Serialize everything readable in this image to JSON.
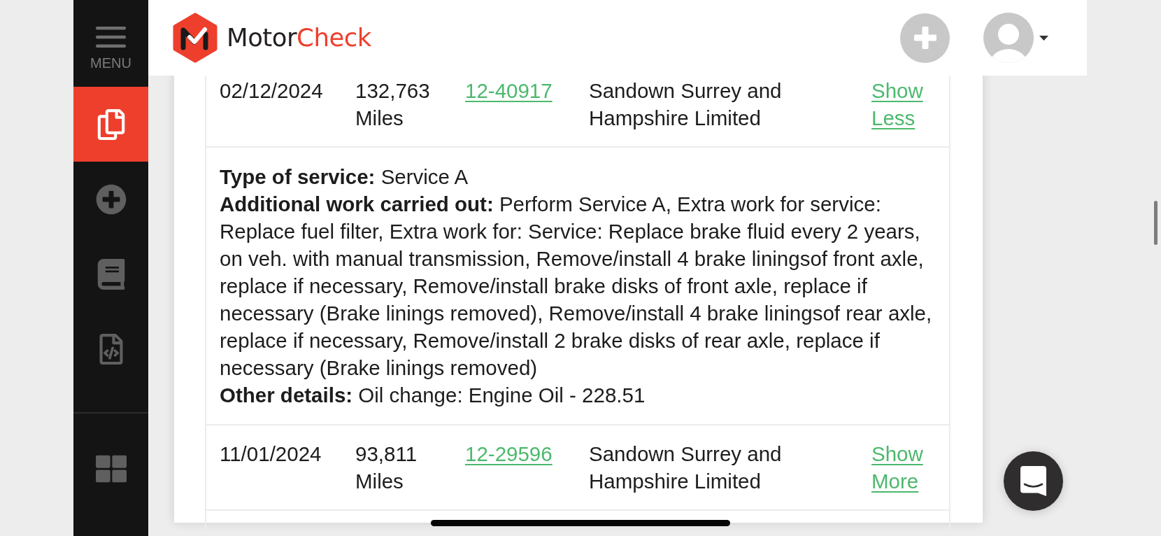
{
  "sidebar": {
    "menu_label": "MENU",
    "items": [
      {
        "selected": true
      },
      {
        "selected": false
      },
      {
        "selected": false
      },
      {
        "selected": false
      }
    ],
    "bottom_items": [
      {
        "selected": false
      }
    ]
  },
  "header": {
    "brand": [
      {
        "text": "Motor",
        "color": "#231f20"
      },
      {
        "text": "Check",
        "color": "#ee3f2d"
      }
    ]
  },
  "service_history": {
    "rows": [
      {
        "date": "02/12/2024",
        "mileage": "132,763 Miles",
        "invoice": "12-40917",
        "garage": "Sandown Surrey and Hampshire Limited",
        "toggle": "Show Less",
        "expanded": true,
        "details": [
          {
            "label": "Type of service:",
            "value": "Service A"
          },
          {
            "label": "Additional work carried out:",
            "value": "Perform Service A, Extra work for service: Replace fuel filter, Extra work for: Service: Replace brake fluid every 2 years, on veh. with manual transmission, Remove/install 4 brake liningsof front axle, replace if necessary, Remove/install brake disks of front axle, replace if necessary (Brake linings removed), Remove/install 4 brake liningsof rear axle, replace if necessary, Remove/install 2 brake disks of rear axle, replace if necessary (Brake linings removed)"
          },
          {
            "label": "Other details:",
            "value": "Oil change: Engine Oil - 228.51"
          }
        ]
      },
      {
        "date": "11/01/2024",
        "mileage": "93,811 Miles",
        "invoice": "12-29596",
        "garage": "Sandown Surrey and Hampshire Limited",
        "toggle": "Show More",
        "expanded": false
      }
    ]
  }
}
